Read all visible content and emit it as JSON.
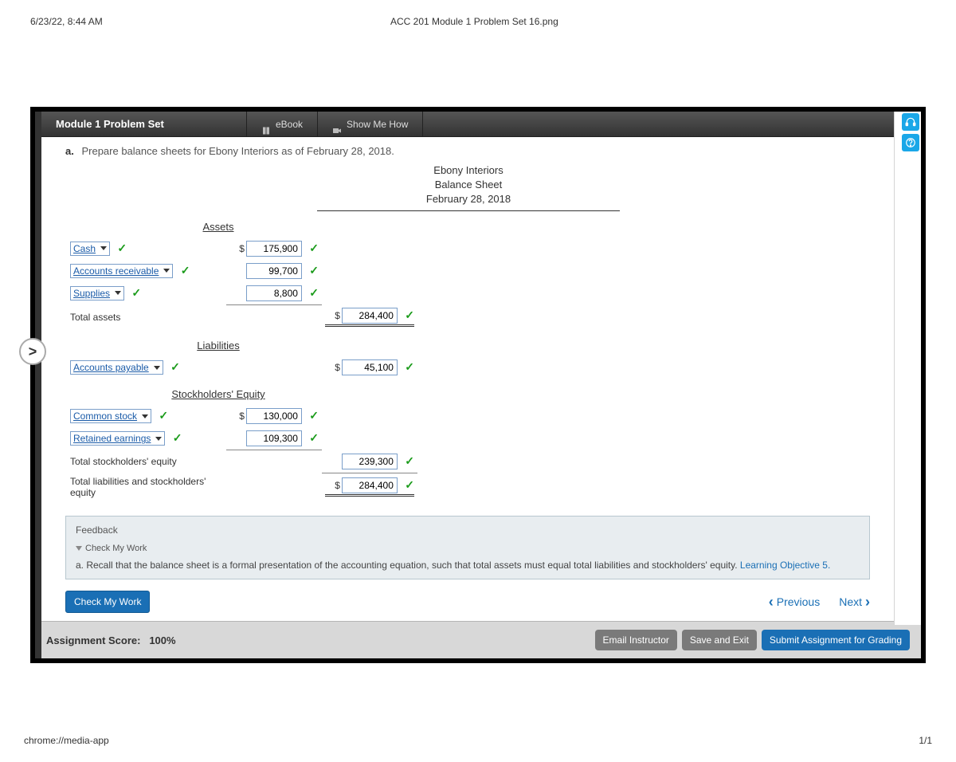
{
  "print": {
    "datetime": "6/23/22, 8:44 AM",
    "title": "ACC 201 Module 1 Problem Set 16.png",
    "footer_left": "chrome://media-app",
    "footer_right": "1/1"
  },
  "toolbar": {
    "title": "Module 1 Problem Set",
    "ebook": "eBook",
    "showme": "Show Me How"
  },
  "side": {
    "headset": "headset-icon",
    "help": "help-icon"
  },
  "instruction": {
    "letter": "a.",
    "text": "Prepare balance sheets for Ebony Interiors as of February 28, 2018."
  },
  "sheet": {
    "company": "Ebony Interiors",
    "stmt": "Balance Sheet",
    "date": "February 28, 2018",
    "sec_assets": "Assets",
    "sec_liab": "Liabilities",
    "sec_equity": "Stockholders' Equity",
    "rows": {
      "cash": "Cash",
      "ar": "Accounts receivable",
      "supplies": "Supplies",
      "total_assets": "Total assets",
      "ap": "Accounts payable",
      "cs": "Common stock",
      "re": "Retained earnings",
      "tse": "Total stockholders' equity",
      "tlse": "Total liabilities and stockholders' equity"
    },
    "vals": {
      "cash": "175,900",
      "ar": "99,700",
      "supplies": "8,800",
      "total_assets": "284,400",
      "ap": "45,100",
      "cs": "130,000",
      "re": "109,300",
      "tse": "239,300",
      "tlse": "284,400"
    }
  },
  "feedback": {
    "title": "Feedback",
    "cmw": "Check My Work",
    "body_a": "a. Recall that the balance sheet is a formal presentation of the accounting equation, such that total assets must equal total liabilities and stockholders' equity. ",
    "link": "Learning Objective 5."
  },
  "actions": {
    "check": "Check My Work",
    "prev": "Previous",
    "next": "Next"
  },
  "footer": {
    "score_label": "Assignment Score:",
    "score_val": "100%",
    "email": "Email Instructor",
    "save": "Save and Exit",
    "submit": "Submit Assignment for Grading"
  },
  "chart_data": {
    "type": "table",
    "title": "Ebony Interiors — Balance Sheet — February 28, 2018",
    "sections": [
      {
        "name": "Assets",
        "lines": [
          {
            "label": "Cash",
            "amount": 175900
          },
          {
            "label": "Accounts receivable",
            "amount": 99700
          },
          {
            "label": "Supplies",
            "amount": 8800
          }
        ],
        "total": {
          "label": "Total assets",
          "amount": 284400
        }
      },
      {
        "name": "Liabilities",
        "lines": [
          {
            "label": "Accounts payable",
            "amount": 45100
          }
        ]
      },
      {
        "name": "Stockholders' Equity",
        "lines": [
          {
            "label": "Common stock",
            "amount": 130000
          },
          {
            "label": "Retained earnings",
            "amount": 109300
          }
        ],
        "total": {
          "label": "Total stockholders' equity",
          "amount": 239300
        }
      }
    ],
    "grand_total": {
      "label": "Total liabilities and stockholders' equity",
      "amount": 284400
    }
  }
}
